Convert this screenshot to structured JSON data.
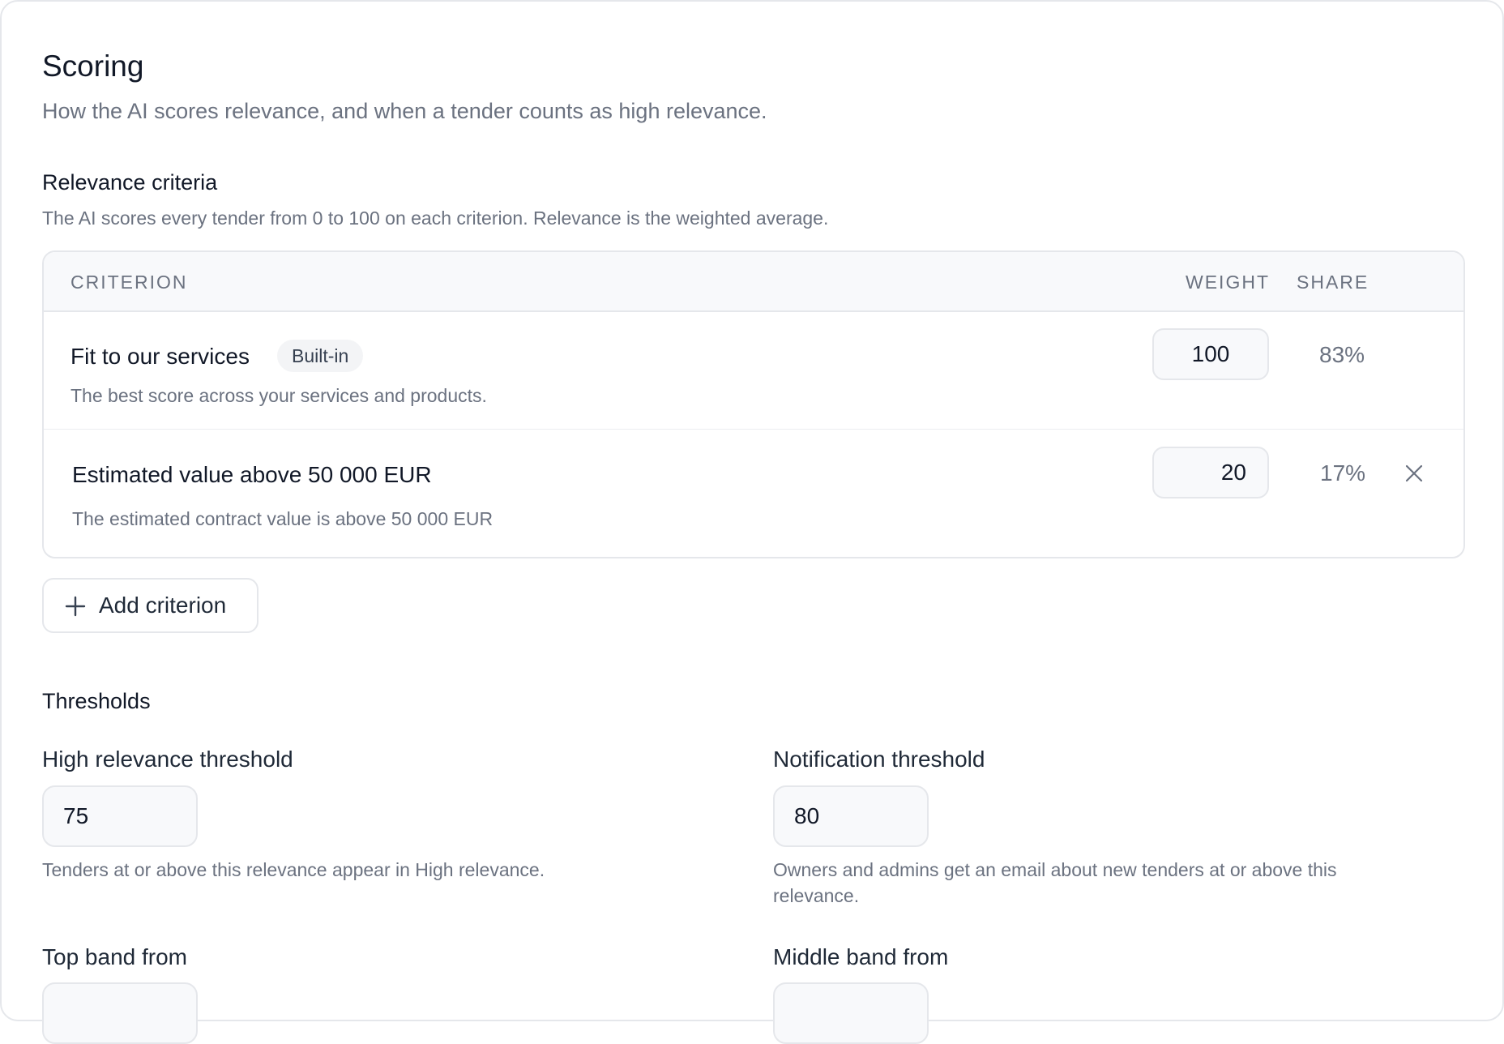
{
  "header": {
    "title": "Scoring",
    "subtitle": "How the AI scores relevance, and when a tender counts as high relevance."
  },
  "criteria_section": {
    "title": "Relevance criteria",
    "help": "The AI scores every tender from 0 to 100 on each criterion. Relevance is the weighted average.",
    "columns": {
      "criterion": "CRITERION",
      "weight": "WEIGHT",
      "share": "SHARE"
    },
    "rows": [
      {
        "name": "Fit to our services",
        "badge": "Built-in",
        "description": "The best score across your services and products.",
        "weight": "100",
        "share": "83%"
      },
      {
        "name": "Estimated value above 50 000 EUR",
        "description": "The estimated contract value is above 50 000 EUR",
        "weight": "20",
        "share": "17%",
        "remove_icon": "close-icon"
      }
    ],
    "add_button_label": "Add criterion",
    "add_icon": "plus-icon"
  },
  "thresholds_section": {
    "title": "Thresholds",
    "high_relevance": {
      "label": "High relevance threshold",
      "value": "75",
      "help": "Tenders at or above this relevance appear in High relevance."
    },
    "notification": {
      "label": "Notification threshold",
      "value": "80",
      "help": "Owners and admins get an email about new tenders at or above this relevance."
    },
    "top_band": {
      "label": "Top band from"
    },
    "middle_band": {
      "label": "Middle band from"
    }
  }
}
